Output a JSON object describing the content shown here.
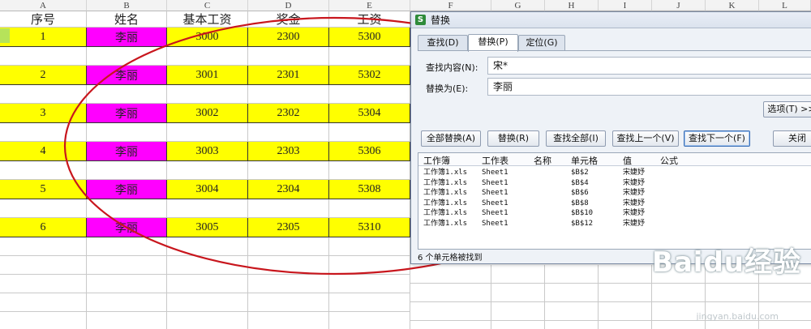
{
  "sheet": {
    "columns": [
      "A",
      "B",
      "C",
      "D",
      "E",
      "F",
      "G",
      "H",
      "I",
      "J",
      "K",
      "L"
    ],
    "headers": [
      "序号",
      "姓名",
      "基本工资",
      "奖金",
      "工资"
    ],
    "rows": [
      {
        "seq": "1",
        "name": "李丽",
        "base": "3000",
        "bonus": "2300",
        "total": "5300"
      },
      {
        "seq": "2",
        "name": "李丽",
        "base": "3001",
        "bonus": "2301",
        "total": "5302"
      },
      {
        "seq": "3",
        "name": "李丽",
        "base": "3002",
        "bonus": "2302",
        "total": "5304"
      },
      {
        "seq": "4",
        "name": "李丽",
        "base": "3003",
        "bonus": "2303",
        "total": "5306"
      },
      {
        "seq": "5",
        "name": "李丽",
        "base": "3004",
        "bonus": "2304",
        "total": "5308"
      },
      {
        "seq": "6",
        "name": "李丽",
        "base": "3005",
        "bonus": "2305",
        "total": "5310"
      }
    ],
    "colors": {
      "yellow": "#ffff00",
      "magenta": "#ff00ff"
    }
  },
  "dialog": {
    "title": "替换",
    "logo": "S",
    "tabs": [
      "查找(D)",
      "替换(P)",
      "定位(G)"
    ],
    "active_tab": "替换(P)",
    "find_label": "查找内容(N):",
    "find_value": "宋*",
    "replace_label": "替换为(E):",
    "replace_value": "李丽",
    "options_button": "选项(T) >>",
    "buttons": [
      "全部替换(A)",
      "替换(R)",
      "查找全部(I)",
      "查找上一个(V)",
      "查找下一个(F)",
      "关闭"
    ],
    "result_columns": [
      "工作簿",
      "工作表",
      "名称",
      "单元格",
      "值",
      "公式"
    ],
    "results": [
      {
        "book": "工作簿1.xls",
        "sheet": "Sheet1",
        "cell": "$B$2",
        "value": "宋婕妤"
      },
      {
        "book": "工作簿1.xls",
        "sheet": "Sheet1",
        "cell": "$B$4",
        "value": "宋婕妤"
      },
      {
        "book": "工作簿1.xls",
        "sheet": "Sheet1",
        "cell": "$B$6",
        "value": "宋婕妤"
      },
      {
        "book": "工作簿1.xls",
        "sheet": "Sheet1",
        "cell": "$B$8",
        "value": "宋婕妤"
      },
      {
        "book": "工作簿1.xls",
        "sheet": "Sheet1",
        "cell": "$B$10",
        "value": "宋婕妤"
      },
      {
        "book": "工作簿1.xls",
        "sheet": "Sheet1",
        "cell": "$B$12",
        "value": "宋婕妤"
      }
    ],
    "status": "6 个单元格被找到"
  },
  "annotation": {
    "color": "#c8161d"
  },
  "watermark": {
    "text": "Baidu经验",
    "subtext": "jingyan.baidu.com"
  }
}
